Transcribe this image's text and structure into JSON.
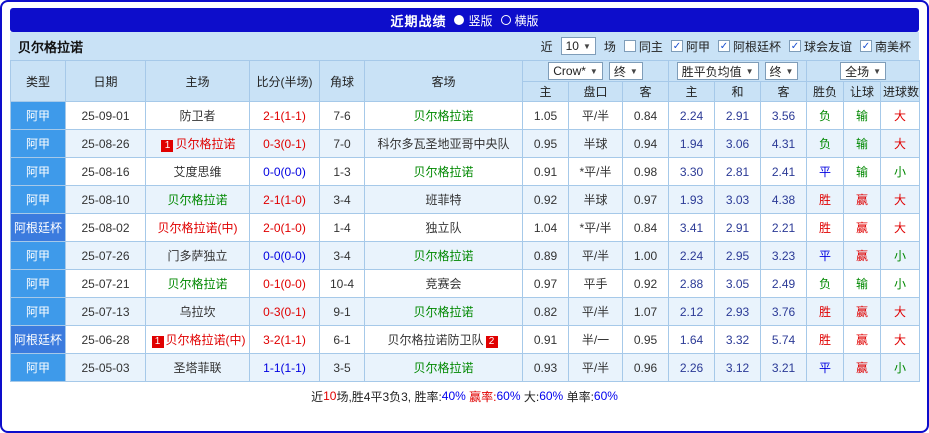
{
  "title": {
    "text": "近期战绩",
    "radios": [
      {
        "label": "竖版",
        "selected": true
      },
      {
        "label": "横版",
        "selected": false
      }
    ]
  },
  "filter": {
    "team": "贝尔格拉诺",
    "near_label": "近",
    "matches_select": "10",
    "unit_label": "场",
    "checkboxes": [
      {
        "label": "同主",
        "checked": false
      },
      {
        "label": "阿甲",
        "checked": true
      },
      {
        "label": "阿根廷杯",
        "checked": true
      },
      {
        "label": "球会友谊",
        "checked": true
      },
      {
        "label": "南美杯",
        "checked": true
      }
    ]
  },
  "header": {
    "type": "类型",
    "date": "日期",
    "home": "主场",
    "score": "比分(半场)",
    "corner": "角球",
    "away": "客场",
    "odds_book": "Crow*",
    "odds_final": "终",
    "avg_label": "胜平负均值",
    "avg_final": "终",
    "scope": "全场",
    "sub": {
      "o_home": "主",
      "pankou": "盘口",
      "o_away": "客",
      "a_home": "主",
      "a_draw": "和",
      "a_away": "客",
      "result": "胜负",
      "handicap": "让球",
      "goals": "进球数"
    }
  },
  "rows": [
    {
      "type": "阿甲",
      "date": "25-09-01",
      "home": "防卫者",
      "home_color": "black",
      "home_badge": "",
      "score": "2-1(1-1)",
      "score_color": "red",
      "corner": "7-6",
      "away": "贝尔格拉诺",
      "away_color": "green",
      "away_badge": "",
      "odds_home": "1.05",
      "handicap": "平/半",
      "handicap_color": "black",
      "odds_away": "0.84",
      "avg_win": "2.24",
      "avg_draw": "2.91",
      "avg_lose": "3.56",
      "outcome": "负",
      "outcome_color": "green",
      "cover": "输",
      "cover_color": "green",
      "totals": "大",
      "totals_color": "red"
    },
    {
      "type": "阿甲",
      "date": "25-08-26",
      "home": "贝尔格拉诺",
      "home_color": "red",
      "home_badge": "1",
      "score": "0-3(0-1)",
      "score_color": "red",
      "corner": "7-0",
      "away": "科尔多瓦圣地亚哥中央队",
      "away_color": "black",
      "away_badge": "",
      "odds_home": "0.95",
      "handicap": "半球",
      "handicap_color": "black",
      "odds_away": "0.94",
      "avg_win": "1.94",
      "avg_draw": "3.06",
      "avg_lose": "4.31",
      "outcome": "负",
      "outcome_color": "green",
      "cover": "输",
      "cover_color": "green",
      "totals": "大",
      "totals_color": "red"
    },
    {
      "type": "阿甲",
      "date": "25-08-16",
      "home": "艾度思维",
      "home_color": "black",
      "home_badge": "",
      "score": "0-0(0-0)",
      "score_color": "blue",
      "corner": "1-3",
      "away": "贝尔格拉诺",
      "away_color": "green",
      "away_badge": "",
      "odds_home": "0.91",
      "handicap": "*平/半",
      "handicap_color": "red",
      "odds_away": "0.98",
      "avg_win": "3.30",
      "avg_draw": "2.81",
      "avg_lose": "2.41",
      "outcome": "平",
      "outcome_color": "blue",
      "cover": "输",
      "cover_color": "green",
      "totals": "小",
      "totals_color": "green"
    },
    {
      "type": "阿甲",
      "date": "25-08-10",
      "home": "贝尔格拉诺",
      "home_color": "green",
      "home_badge": "",
      "score": "2-1(1-0)",
      "score_color": "red",
      "corner": "3-4",
      "away": "班菲特",
      "away_color": "black",
      "away_badge": "",
      "odds_home": "0.92",
      "handicap": "半球",
      "handicap_color": "black",
      "odds_away": "0.97",
      "avg_win": "1.93",
      "avg_draw": "3.03",
      "avg_lose": "4.38",
      "outcome": "胜",
      "outcome_color": "red",
      "cover": "赢",
      "cover_color": "red",
      "totals": "大",
      "totals_color": "red"
    },
    {
      "type": "阿根廷杯",
      "date": "25-08-02",
      "home": "贝尔格拉诺(中)",
      "home_color": "red",
      "home_badge": "",
      "score": "2-0(1-0)",
      "score_color": "red",
      "corner": "1-4",
      "away": "独立队",
      "away_color": "black",
      "away_badge": "",
      "odds_home": "1.04",
      "handicap": "*平/半",
      "handicap_color": "red",
      "odds_away": "0.84",
      "avg_win": "3.41",
      "avg_draw": "2.91",
      "avg_lose": "2.21",
      "outcome": "胜",
      "outcome_color": "red",
      "cover": "赢",
      "cover_color": "red",
      "totals": "大",
      "totals_color": "red"
    },
    {
      "type": "阿甲",
      "date": "25-07-26",
      "home": "门多萨独立",
      "home_color": "black",
      "home_badge": "",
      "score": "0-0(0-0)",
      "score_color": "blue",
      "corner": "3-4",
      "away": "贝尔格拉诺",
      "away_color": "green",
      "away_badge": "",
      "odds_home": "0.89",
      "handicap": "平/半",
      "handicap_color": "black",
      "odds_away": "1.00",
      "avg_win": "2.24",
      "avg_draw": "2.95",
      "avg_lose": "3.23",
      "outcome": "平",
      "outcome_color": "blue",
      "cover": "赢",
      "cover_color": "red",
      "totals": "小",
      "totals_color": "green"
    },
    {
      "type": "阿甲",
      "date": "25-07-21",
      "home": "贝尔格拉诺",
      "home_color": "green",
      "home_badge": "",
      "score": "0-1(0-0)",
      "score_color": "red",
      "corner": "10-4",
      "away": "竞赛会",
      "away_color": "black",
      "away_badge": "",
      "odds_home": "0.97",
      "handicap": "平手",
      "handicap_color": "black",
      "odds_away": "0.92",
      "avg_win": "2.88",
      "avg_draw": "3.05",
      "avg_lose": "2.49",
      "outcome": "负",
      "outcome_color": "green",
      "cover": "输",
      "cover_color": "green",
      "totals": "小",
      "totals_color": "green"
    },
    {
      "type": "阿甲",
      "date": "25-07-13",
      "home": "乌拉坎",
      "home_color": "black",
      "home_badge": "",
      "score": "0-3(0-1)",
      "score_color": "red",
      "corner": "9-1",
      "away": "贝尔格拉诺",
      "away_color": "green",
      "away_badge": "",
      "odds_home": "0.82",
      "handicap": "平/半",
      "handicap_color": "black",
      "odds_away": "1.07",
      "avg_win": "2.12",
      "avg_draw": "2.93",
      "avg_lose": "3.76",
      "outcome": "胜",
      "outcome_color": "red",
      "cover": "赢",
      "cover_color": "red",
      "totals": "大",
      "totals_color": "red"
    },
    {
      "type": "阿根廷杯",
      "date": "25-06-28",
      "home": "贝尔格拉诺(中)",
      "home_color": "red",
      "home_badge": "1",
      "score": "3-2(1-1)",
      "score_color": "red",
      "corner": "6-1",
      "away": "贝尔格拉诺防卫队",
      "away_color": "black",
      "away_badge": "2",
      "odds_home": "0.91",
      "handicap": "半/一",
      "handicap_color": "black",
      "odds_away": "0.95",
      "avg_win": "1.64",
      "avg_draw": "3.32",
      "avg_lose": "5.74",
      "outcome": "胜",
      "outcome_color": "red",
      "cover": "赢",
      "cover_color": "red",
      "totals": "大",
      "totals_color": "red"
    },
    {
      "type": "阿甲",
      "date": "25-05-03",
      "home": "圣塔菲联",
      "home_color": "black",
      "home_badge": "",
      "score": "1-1(1-1)",
      "score_color": "blue",
      "corner": "3-5",
      "away": "贝尔格拉诺",
      "away_color": "green",
      "away_badge": "",
      "odds_home": "0.93",
      "handicap": "平/半",
      "handicap_color": "black",
      "odds_away": "0.96",
      "avg_win": "2.26",
      "avg_draw": "3.12",
      "avg_lose": "3.21",
      "outcome": "平",
      "outcome_color": "blue",
      "cover": "赢",
      "cover_color": "red",
      "totals": "小",
      "totals_color": "green"
    }
  ],
  "summary": {
    "parts": [
      "近",
      "10",
      "场,胜4平3负3, 胜率:",
      "40%",
      " 赢率:",
      "60%",
      " 大:",
      "60%",
      " 单率:",
      "60%"
    ]
  },
  "colors": {
    "accent": "#0D0DCB",
    "bar_bg": "#C9E2F6",
    "row_alt": "#E9F3FC",
    "grid": "#A6C9E9",
    "league_afa": "#3E9AEA",
    "league_cup": "#3B7BDE",
    "red": "#E00000",
    "green": "#008800",
    "blue": "#0000E0",
    "odds": "#333333",
    "avg": "#2B3A96"
  }
}
